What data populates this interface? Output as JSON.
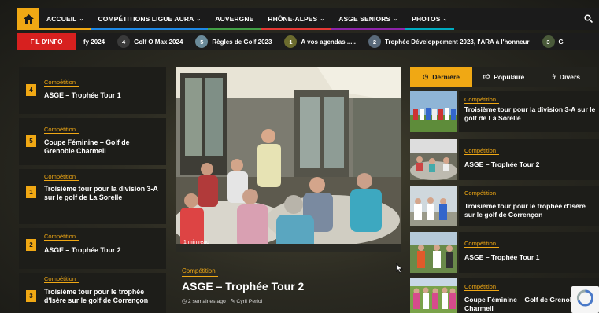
{
  "nav": {
    "items": [
      {
        "label": "ACCUEIL",
        "chevron": "⌄",
        "bar": "#f0a814"
      },
      {
        "label": "COMPÉTITIONS LIGUE AURA",
        "chevron": "⌄",
        "bar": "#1e88e5"
      },
      {
        "label": "AUVERGNE",
        "chevron": "",
        "bar": "#43a047"
      },
      {
        "label": "RHÔNE-ALPES",
        "chevron": "⌄",
        "bar": "#e53935"
      },
      {
        "label": "ASGE SENIORS",
        "chevron": "⌄",
        "bar": "#8e24aa"
      },
      {
        "label": "PHOTOS",
        "chevron": "⌄",
        "bar": "#00acc1"
      }
    ]
  },
  "ticker": {
    "label": "FIL D'INFO",
    "items": [
      {
        "num": "",
        "text": "fy 2024",
        "color": ""
      },
      {
        "num": "4",
        "text": "Golf O Max 2024",
        "color": "#3a3a3a"
      },
      {
        "num": "5",
        "text": "Règles de Golf 2023",
        "color": "#6a8a9a"
      },
      {
        "num": "1",
        "text": "A vos agendas .....",
        "color": "#6b6b2e"
      },
      {
        "num": "2",
        "text": "Trophée Développement 2023, l'ARA à l'honneur",
        "color": "#5a6a7a"
      },
      {
        "num": "3",
        "text": "G",
        "color": "#4a5a3a"
      }
    ]
  },
  "left": [
    {
      "rank": "4",
      "category": "Compétition",
      "title": "ASGE – Trophée Tour 1"
    },
    {
      "rank": "5",
      "category": "Compétition",
      "title": "Coupe Féminine – Golf de Grenoble Charmeil"
    },
    {
      "rank": "1",
      "category": "Compétition",
      "title": "Troisième tour pour la division 3-A sur le golf de La Sorelle"
    },
    {
      "rank": "2",
      "category": "Compétition",
      "title": "ASGE – Trophée Tour 2"
    },
    {
      "rank": "3",
      "category": "Compétition",
      "title": "Troisième tour pour le trophée d'Isère sur le golf de Corrençon"
    }
  ],
  "featured": {
    "read_time": "1 min read",
    "category": "Compétition",
    "title": "ASGE – Trophée Tour 2",
    "date": "2 semaines ago",
    "author": "Cyril Periol"
  },
  "tabs": {
    "latest": "Dernière",
    "popular": "Populaire",
    "misc": "Divers"
  },
  "right": [
    {
      "category": "Compétition",
      "title": "Troisième tour pour la division 3-A sur le golf de La Sorelle"
    },
    {
      "category": "Compétition",
      "title": "ASGE – Trophée Tour 2"
    },
    {
      "category": "Compétition",
      "title": "Troisième tour pour le trophée d'Isère sur le golf de Corrençon"
    },
    {
      "category": "Compétition",
      "title": "ASGE – Trophée Tour 1"
    },
    {
      "category": "Compétition",
      "title": "Coupe Féminine – Golf de Grenoble Charmeil"
    }
  ],
  "colors": {
    "accent": "#f0a814",
    "fil_info": "#d7201f",
    "nav_bg": "#1b1b1b"
  }
}
